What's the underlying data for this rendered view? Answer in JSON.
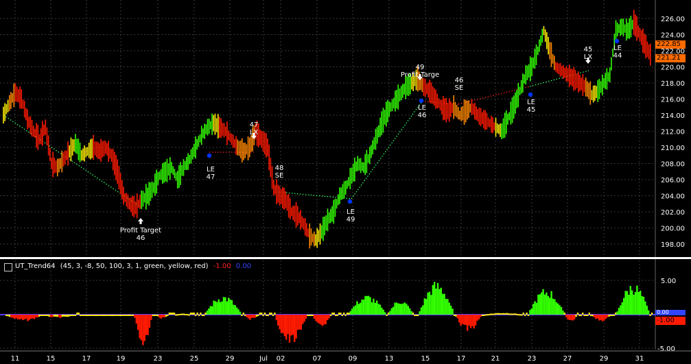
{
  "colors": {
    "background": "#000000",
    "grid": "#3a3a3a",
    "up": "#33ff00",
    "mid": "#ffee00",
    "down": "#ff1a00",
    "orange": "#ff8800",
    "dotted_long": "#33ff66",
    "dotted_short": "#ff2222",
    "entry_marker": "#0033ff",
    "indicator_base": "#5a39ff"
  },
  "price_axis": {
    "labels": [
      "226.00",
      "224.00",
      "222.00",
      "220.00",
      "218.00",
      "216.00",
      "214.00",
      "212.00",
      "210.00",
      "208.00",
      "206.00",
      "204.00",
      "202.00",
      "200.00",
      "198.00"
    ],
    "current_tags": [
      {
        "value": "222.85",
        "color": "#ff6a00"
      },
      {
        "value": "221.21",
        "color": "#ff6a00"
      }
    ]
  },
  "date_axis": {
    "labels": [
      "11",
      "15",
      "17",
      "19",
      "23",
      "25",
      "29",
      "Jul",
      "02",
      "07",
      "09",
      "13",
      "15",
      "17",
      "21",
      "23",
      "27",
      "29",
      "31"
    ]
  },
  "signals": [
    {
      "text": "Profit Target",
      "sub": "46"
    },
    {
      "text": "LE",
      "sub": "47"
    },
    {
      "text": "47",
      "sub": "LX"
    },
    {
      "text": "48",
      "sub": "SE"
    },
    {
      "text": "LE",
      "sub": "49"
    },
    {
      "text": "49",
      "sub": "Profit Targe"
    },
    {
      "text": "LE",
      "sub": "46"
    },
    {
      "text": "46",
      "sub": "SE"
    },
    {
      "text": "LE",
      "sub": "45"
    },
    {
      "text": "45",
      "sub": "LX"
    },
    {
      "text": "LE",
      "sub": "44"
    }
  ],
  "indicator": {
    "name": "UT_Trend64",
    "params": "(45, 3, -8, 50, 100, 3, 1, green, yellow, red)",
    "value1": "-1.00",
    "value2": "0.00",
    "axis_labels": [
      "5.00",
      "-5.00"
    ],
    "current_tags": [
      {
        "value": "0.00",
        "color": "#3344ff"
      },
      {
        "value": "-1.00",
        "color": "#ff1a00"
      }
    ]
  },
  "chart_data": {
    "type": "line",
    "title": "",
    "ylim": [
      197,
      227
    ],
    "series": [
      {
        "values": [
          214,
          215.5,
          216.8,
          216,
          213.5,
          212,
          211,
          212.5,
          208,
          207.5,
          208.5,
          209.5,
          210.5,
          209,
          209.5,
          210,
          209.5,
          210,
          209,
          207,
          204,
          203,
          202.5,
          203.5,
          204,
          205,
          206.5,
          207,
          207.5,
          206,
          207.5,
          208.5,
          210,
          211.5,
          212.5,
          213,
          212.5,
          212,
          211,
          210,
          209.5,
          210,
          212,
          211,
          210,
          205,
          204,
          203.5,
          202,
          201.5,
          200.5,
          199,
          198.5,
          199.5,
          201,
          202,
          204,
          205,
          206.5,
          208,
          207.5,
          209,
          211,
          213,
          214.5,
          215.5,
          216.5,
          217.5,
          218,
          218.5,
          217.5,
          217,
          216,
          215,
          214.5,
          215,
          214,
          214.5,
          215,
          214,
          213.5,
          213,
          212.5,
          212,
          213.5,
          215,
          217,
          219,
          220,
          222,
          224.5,
          222,
          220,
          219.5,
          219,
          218.5,
          218,
          217.5,
          216.5,
          217,
          218,
          219,
          224.5,
          225,
          224.5,
          225.5,
          224,
          222.5,
          221.2
        ]
      }
    ]
  }
}
